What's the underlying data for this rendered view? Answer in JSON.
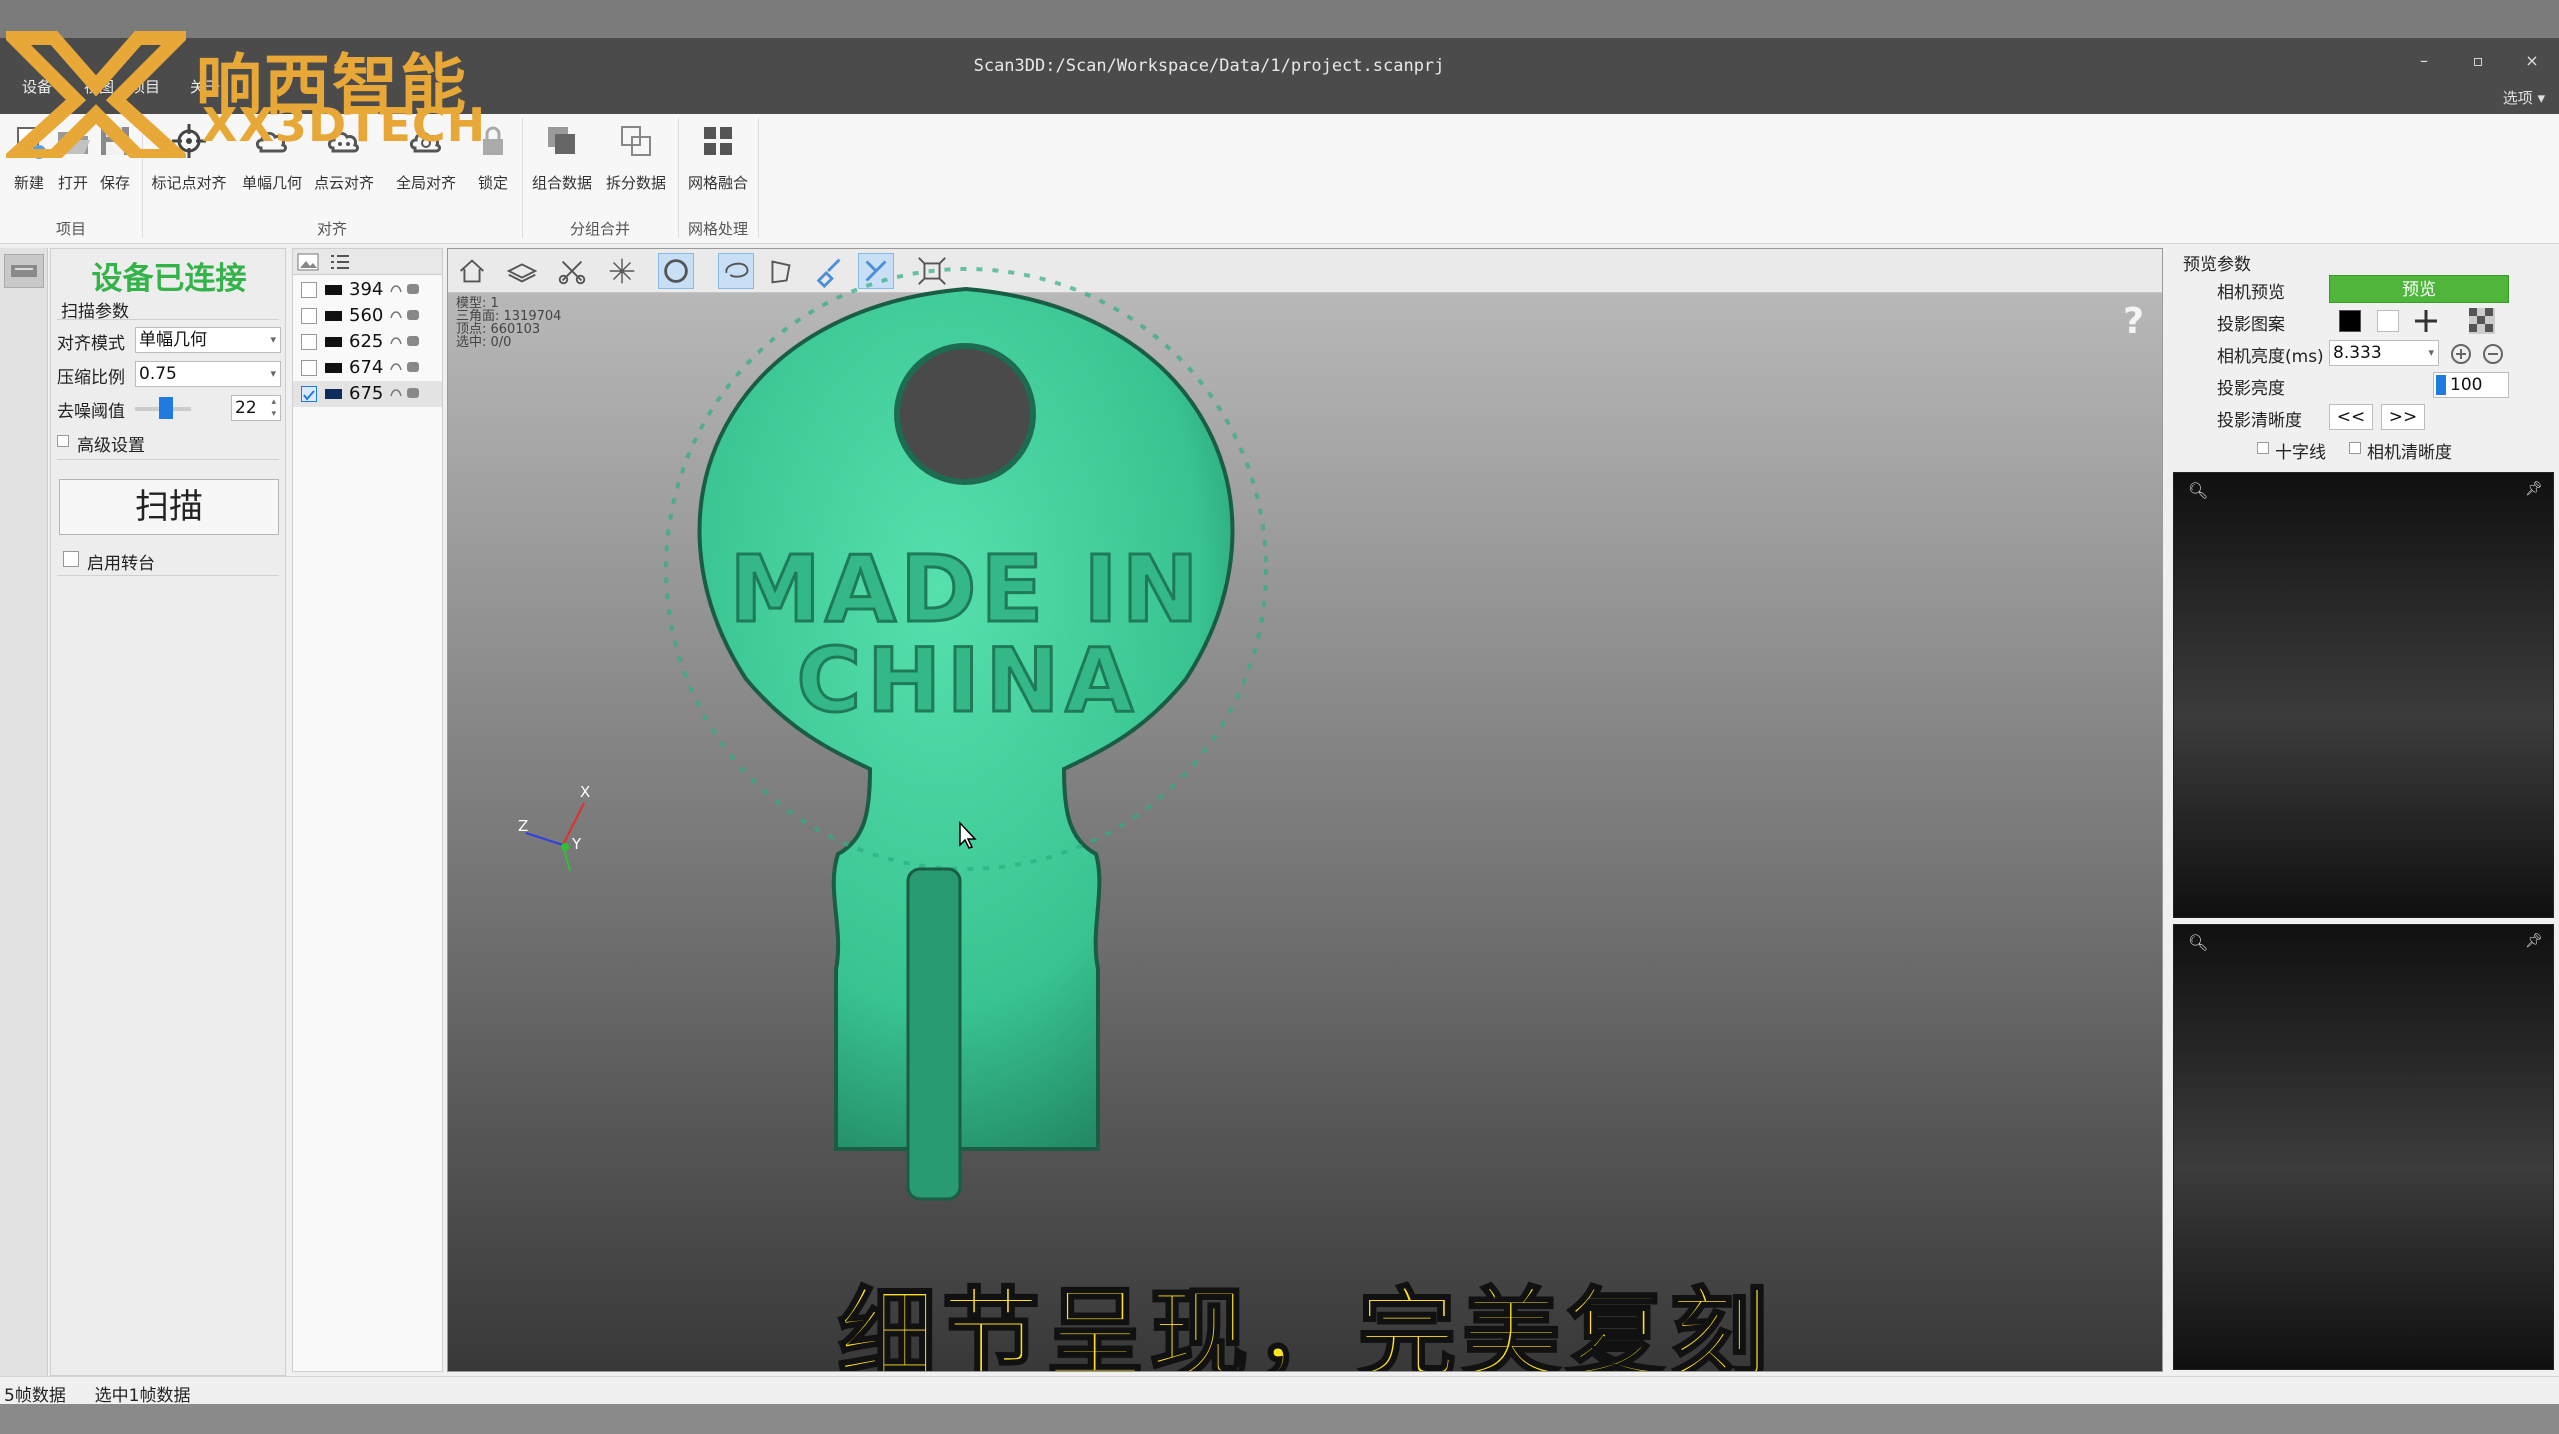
{
  "window": {
    "title": "Scan3DD:/Scan/Workspace/Data/1/project.scanprj",
    "minimize": "–",
    "restore": "▫",
    "close": "×",
    "options": "选项 ▾"
  },
  "menu": [
    "设备",
    "视图",
    "项目",
    "关于"
  ],
  "logo": {
    "cn": "响西智能",
    "en": "XX3DTECH"
  },
  "ribbon": {
    "buttons": {
      "new": "新建",
      "open": "打开",
      "save": "保存",
      "marker_align": "标记点对齐",
      "single_geo": "单幅几何",
      "cloud_align": "点云对齐",
      "global_align": "全局对齐",
      "lock": "锁定",
      "combine": "组合数据",
      "split": "拆分数据",
      "mesh_fuse": "网格融合"
    },
    "groups": {
      "project": "项目",
      "align": "对齐",
      "group_merge": "分组合并",
      "mesh": "网格处理"
    }
  },
  "left_panel": {
    "status": "设备已连接",
    "section": "扫描参数",
    "align_mode_label": "对齐模式",
    "align_mode_value": "单幅几何",
    "compress_label": "压缩比例",
    "compress_value": "0.75",
    "denoise_label": "去噪阈值",
    "denoise_value": "22",
    "advanced": "高级设置",
    "scan_button": "扫描",
    "turntable": "启用转台"
  },
  "frame_list": [
    {
      "id": "394",
      "checked": false
    },
    {
      "id": "560",
      "checked": false
    },
    {
      "id": "625",
      "checked": false
    },
    {
      "id": "674",
      "checked": false
    },
    {
      "id": "675",
      "checked": true
    }
  ],
  "viewport": {
    "stats": [
      "模型: 1",
      "三角面: 1319704",
      "顶点: 660103",
      "选中: 0/0"
    ],
    "model_text_1": "MADE IN",
    "model_text_2": "CHINA",
    "axes": {
      "x": "X",
      "y": "Y",
      "z": "Z"
    },
    "help": "?",
    "subtitle": "细节呈现，完美复刻"
  },
  "right_panel": {
    "section": "预览参数",
    "camera_preview_label": "相机预览",
    "preview_button": "预览",
    "projection_pattern_label": "投影图案",
    "camera_brightness_label": "相机亮度(ms)",
    "camera_brightness_value": "8.333",
    "projection_brightness_label": "投影亮度",
    "projection_brightness_value": "100",
    "projection_sharpness_label": "投影清晰度",
    "prev": "<<",
    "next": ">>",
    "crosshair": "十字线",
    "camera_sharpness": "相机清晰度"
  },
  "status_bar": {
    "frames": "5帧数据",
    "selected": "选中1帧数据"
  },
  "colors": {
    "accent_green": "#4fb53b",
    "model_green": "#3fd09a",
    "logo": "#e8a838",
    "subtitle": "#ffe21d"
  }
}
